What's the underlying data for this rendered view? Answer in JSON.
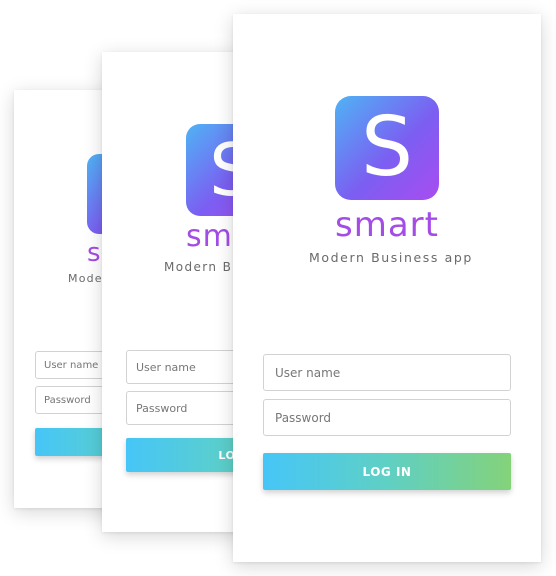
{
  "app": {
    "logo_letter": "S",
    "brand_name": "smart",
    "tagline": "Modern Business app"
  },
  "login": {
    "username_placeholder": "User name",
    "password_placeholder": "Password",
    "login_button": "LOG IN"
  },
  "colors": {
    "brand_purple": "#a44ce6",
    "logo_gradient_start": "#4fb3f5",
    "logo_gradient_end": "#a94cf0",
    "button_gradient_start": "#46c6f8",
    "button_gradient_end": "#84d27a"
  }
}
